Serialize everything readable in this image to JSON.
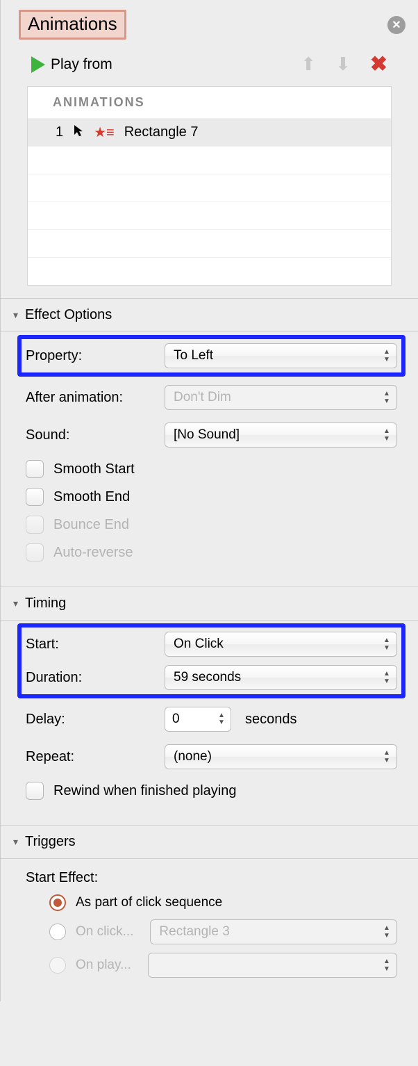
{
  "header": {
    "tab_label": "Animations"
  },
  "toolbar": {
    "play_label": "Play from"
  },
  "anim_list": {
    "header": "ANIMATIONS",
    "items": [
      {
        "index": "1",
        "name": "Rectangle 7"
      }
    ]
  },
  "sections": {
    "effect": {
      "title": "Effect Options",
      "property_label": "Property:",
      "property_value": "To Left",
      "after_label": "After animation:",
      "after_value": "Don't Dim",
      "sound_label": "Sound:",
      "sound_value": "[No Sound]",
      "smooth_start": "Smooth Start",
      "smooth_end": "Smooth End",
      "bounce_end": "Bounce End",
      "auto_reverse": "Auto-reverse"
    },
    "timing": {
      "title": "Timing",
      "start_label": "Start:",
      "start_value": "On Click",
      "duration_label": "Duration:",
      "duration_value": "59 seconds",
      "delay_label": "Delay:",
      "delay_value": "0",
      "delay_unit": "seconds",
      "repeat_label": "Repeat:",
      "repeat_value": "(none)",
      "rewind_label": "Rewind when finished playing"
    },
    "triggers": {
      "title": "Triggers",
      "start_effect_label": "Start Effect:",
      "opt_sequence": "As part of click sequence",
      "opt_onclick": "On click...",
      "opt_onclick_value": "Rectangle 3",
      "opt_onplay": "On play..."
    }
  }
}
